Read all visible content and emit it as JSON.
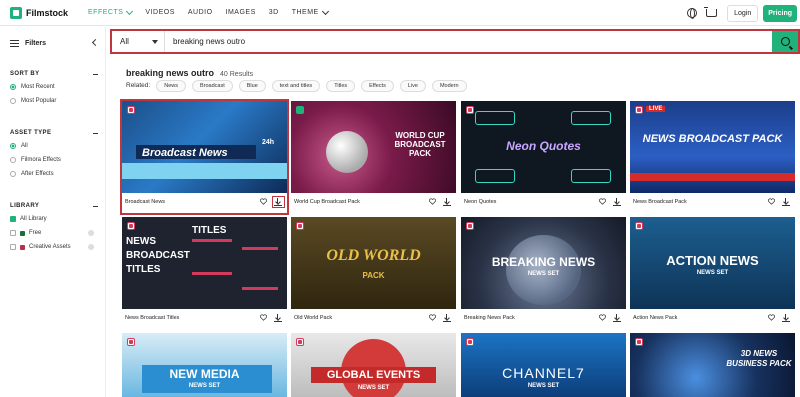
{
  "brand": {
    "name": "Filmstock",
    "accent": "#1fb27a",
    "highlight": "#c0363f"
  },
  "nav": {
    "items": [
      "EFFECTS",
      "VIDEOS",
      "AUDIO",
      "IMAGES",
      "3D",
      "THEME"
    ],
    "login": "Login",
    "pricing": "Pricing"
  },
  "sidebar": {
    "filters": "Filters",
    "sort_by": {
      "title": "SORT BY",
      "options": [
        "Most Recent",
        "Most Popular"
      ],
      "selected": "Most Recent"
    },
    "asset_type": {
      "title": "ASSET TYPE",
      "options": [
        "All",
        "Filmora Effects",
        "After Effects"
      ],
      "selected": "All"
    },
    "library": {
      "title": "LIBRARY",
      "options": [
        "All Library",
        "Free",
        "Creative Assets"
      ],
      "selected": "All Library"
    }
  },
  "search": {
    "scope": "All",
    "query": "breaking news outro"
  },
  "results": {
    "title": "breaking news outro",
    "count": "40 Results",
    "related_label": "Related:",
    "tags": [
      "News",
      "Broadcast",
      "Blue",
      "text and titles",
      "Titles",
      "Effects",
      "Live",
      "Modern"
    ]
  },
  "cards": [
    {
      "caption": "Broadcast News",
      "thumb_text": "Broadcast News",
      "thumb_sub": "24h"
    },
    {
      "caption": "World Cup Broadcast Pack",
      "thumb_text": "WORLD CUP BROADCAST PACK"
    },
    {
      "caption": "Neon Quotes",
      "thumb_text": "Neon Quotes"
    },
    {
      "caption": "News Broadcast Pack",
      "thumb_text": "NEWS BROADCAST PACK",
      "thumb_sub": "LIVE"
    },
    {
      "caption": "News Broadcast Titles",
      "thumb_text": "NEWS BROADCAST TITLES",
      "thumb_sub": "TITLES"
    },
    {
      "caption": "Old World Pack",
      "thumb_text": "OLD WORLD",
      "thumb_sub": "PACK"
    },
    {
      "caption": "Breaking News Pack",
      "thumb_text": "BREAKING NEWS",
      "thumb_sub": "NEWS SET"
    },
    {
      "caption": "Action News Pack",
      "thumb_text": "ACTION NEWS",
      "thumb_sub": "NEWS SET"
    },
    {
      "caption": "",
      "thumb_text": "NEW MEDIA",
      "thumb_sub": "NEWS SET"
    },
    {
      "caption": "",
      "thumb_text": "GLOBAL EVENTS",
      "thumb_sub": "NEWS SET"
    },
    {
      "caption": "",
      "thumb_text": "CHANNEL7",
      "thumb_sub": "NEWS SET"
    },
    {
      "caption": "",
      "thumb_text": "3D NEWS BUSINESS PACK"
    }
  ]
}
